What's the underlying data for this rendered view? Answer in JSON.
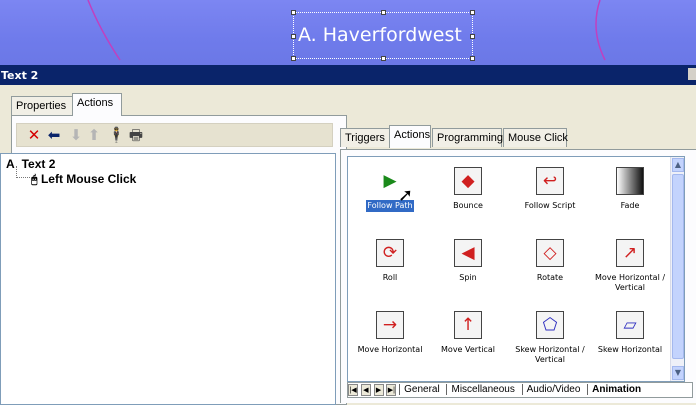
{
  "canvas": {
    "title_text": "A. Haverfordwest",
    "bg_color": "#6f7beb"
  },
  "object_bar": {
    "title": "Text 2"
  },
  "left_panel": {
    "tabs": [
      {
        "label": "Properties",
        "active": false
      },
      {
        "label": "Actions",
        "active": true
      }
    ],
    "toolbar": [
      {
        "icon": "delete-icon",
        "glyph": "✕",
        "color": "#d40000"
      },
      {
        "icon": "arrow-left-icon",
        "glyph": "⬅",
        "color": "#0a246a"
      },
      {
        "icon": "arrow-down-icon",
        "glyph": "⬇",
        "color": "#b5b5b5"
      },
      {
        "icon": "arrow-up-icon",
        "glyph": "⬆",
        "color": "#b5b5b5"
      },
      {
        "icon": "person-icon",
        "glyph": "🕴",
        "color": "#7a6a3a"
      },
      {
        "icon": "print-icon",
        "glyph": "🖶",
        "color": "#444444"
      }
    ],
    "tree": {
      "root_prefix": "A",
      "root_label": "Text 2",
      "child_label": "Left Mouse Click"
    }
  },
  "right_panel": {
    "tabs": [
      {
        "label": "Triggers",
        "active": false
      },
      {
        "label": "Actions",
        "active": true
      },
      {
        "label": "Programming",
        "active": false
      },
      {
        "label": "Mouse Click",
        "active": false
      }
    ],
    "actions": [
      {
        "label": "Follow Path",
        "icon": "follow-path-icon",
        "glyph": "▶",
        "selected": true
      },
      {
        "label": "Bounce",
        "icon": "bounce-icon",
        "glyph": "◆",
        "selected": false
      },
      {
        "label": "Follow Script",
        "icon": "follow-script-icon",
        "glyph": "↩",
        "selected": false
      },
      {
        "label": "Fade",
        "icon": "fade-icon",
        "glyph": "▓",
        "selected": false
      },
      {
        "label": "Roll",
        "icon": "roll-icon",
        "glyph": "⟳",
        "selected": false
      },
      {
        "label": "Spin",
        "icon": "spin-icon",
        "glyph": "◀",
        "selected": false
      },
      {
        "label": "Rotate",
        "icon": "rotate-icon",
        "glyph": "◇",
        "selected": false
      },
      {
        "label": "Move Horizontal / Vertical",
        "icon": "move-hv-icon",
        "glyph": "↗",
        "selected": false
      },
      {
        "label": "Move Horizontal",
        "icon": "move-horizontal-icon",
        "glyph": "→",
        "selected": false
      },
      {
        "label": "Move Vertical",
        "icon": "move-vertical-icon",
        "glyph": "↑",
        "selected": false
      },
      {
        "label": "Skew Horizontal / Vertical",
        "icon": "skew-hv-icon",
        "glyph": "⬠",
        "selected": false
      },
      {
        "label": "Skew Horizontal",
        "icon": "skew-horizontal-icon",
        "glyph": "▱",
        "selected": false
      }
    ],
    "bottom_tabs": [
      {
        "label": "General",
        "active": false
      },
      {
        "label": "Miscellaneous",
        "active": false
      },
      {
        "label": "Audio/Video",
        "active": false
      },
      {
        "label": "Animation",
        "active": true
      }
    ]
  }
}
